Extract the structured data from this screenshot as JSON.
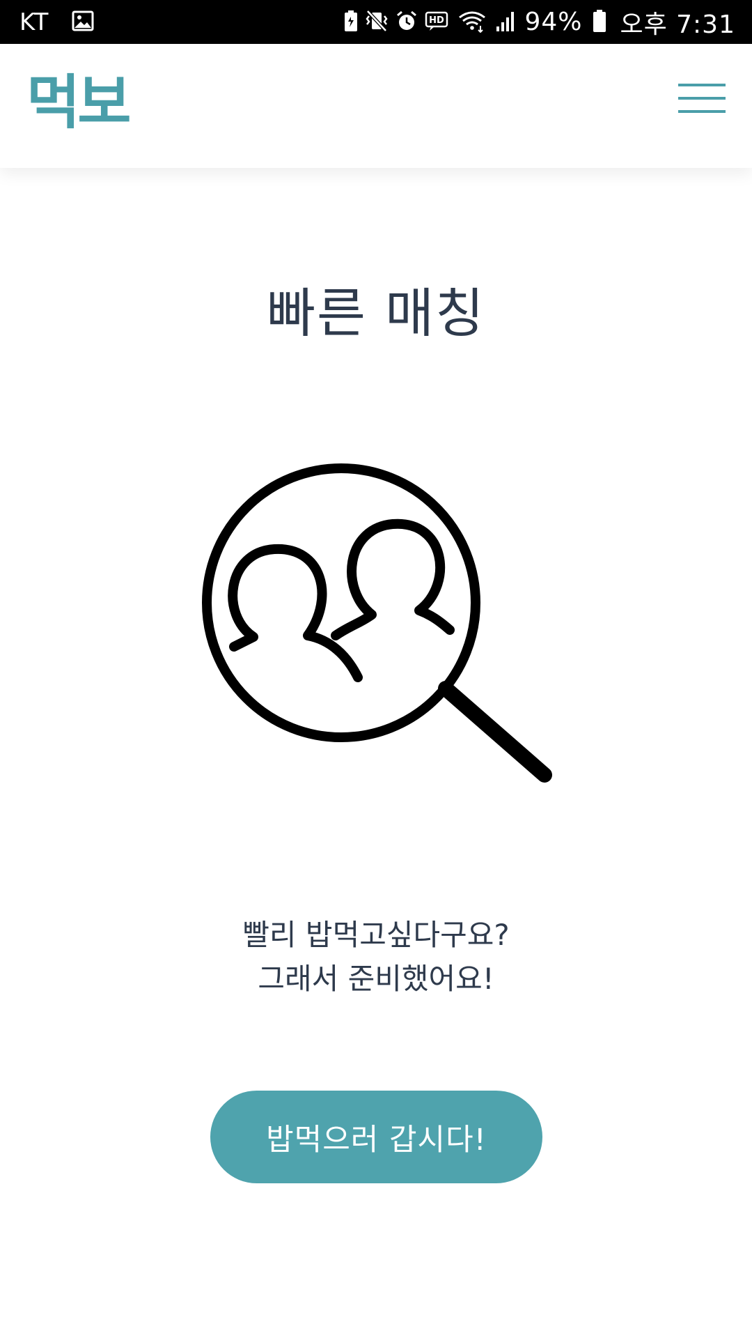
{
  "status_bar": {
    "carrier": "KT",
    "battery_percent": "94%",
    "time": "오후 7:31",
    "icons": [
      "image-icon",
      "battery-saver-icon",
      "vibrate-mute-icon",
      "alarm-icon",
      "hd-icon",
      "wifi-icon",
      "signal-icon",
      "battery-icon"
    ]
  },
  "header": {
    "logo": "먹보",
    "menu_icon": "hamburger-menu-icon"
  },
  "main": {
    "title": "빠른 매칭",
    "illustration_icon": "magnifier-users-icon",
    "description_line1": "빨리 밥먹고싶다구요?",
    "description_line2": "그래서 준비했어요!",
    "cta_label": "밥먹으러 갑시다!"
  },
  "colors": {
    "accent": "#4fa3ad",
    "logo": "#4a9ea9",
    "text": "#2e3a4c",
    "status_bar_bg": "#000000",
    "background": "#ffffff"
  }
}
